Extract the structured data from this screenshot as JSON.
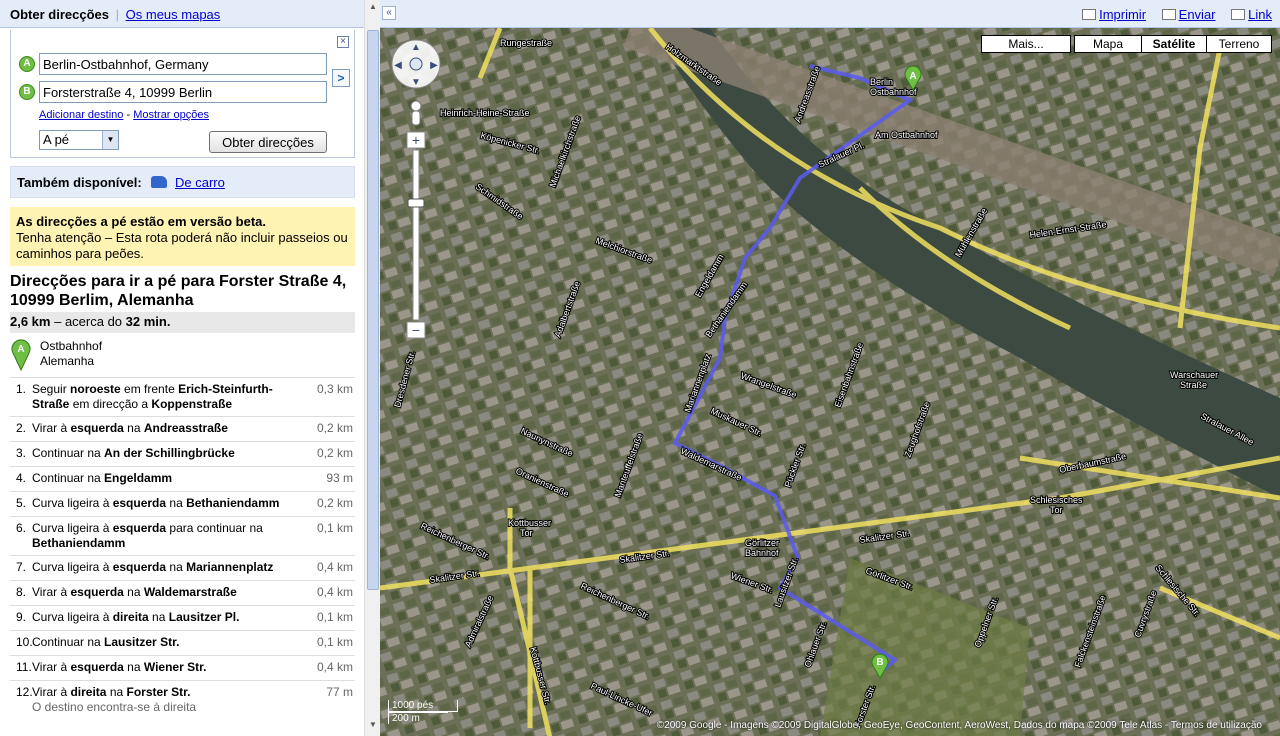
{
  "nav": {
    "current": "Obter direcções",
    "mymaps": "Os meus mapas"
  },
  "form": {
    "from": "Berlin-Ostbahnhof, Germany",
    "to": "Forsterstraße 4, 10999 Berlin",
    "marker_a": "A",
    "marker_b": "B",
    "add_dest": "Adicionar destino",
    "link_sep": "-",
    "show_options": "Mostrar opções",
    "mode": "A pé",
    "get_dir": "Obter direcções",
    "close": "×",
    "swap": ">"
  },
  "also": {
    "label": "Também disponível:",
    "link": "De carro"
  },
  "beta": {
    "title": "As direcções a pé estão em versão beta.",
    "body": "Tenha atenção – Esta rota poderá não incluir passeios ou caminhos para peões."
  },
  "route": {
    "title": "Direcções para ir a pé para Forster Straße 4, 10999 Berlim, Alemanha",
    "distance": "2,6 km",
    "approx": "– acerca do",
    "time": "32 min.",
    "start_name": "Ostbahnhof",
    "start_country": "Alemanha"
  },
  "steps": [
    {
      "n": "1.",
      "text": "Seguir <b>noroeste</b> em frente <b>Erich-Steinfurth-Straße</b> em direcção a <b>Koppenstraße</b>",
      "dist": "0,3 km"
    },
    {
      "n": "2.",
      "text": "Virar à <b>esquerda</b> na <b>Andreasstraße</b>",
      "dist": "0,2 km"
    },
    {
      "n": "3.",
      "text": "Continuar na <b>An der Schillingbrücke</b>",
      "dist": "0,2 km"
    },
    {
      "n": "4.",
      "text": "Continuar na <b>Engeldamm</b>",
      "dist": "93 m"
    },
    {
      "n": "5.",
      "text": "Curva ligeira à <b>esquerda</b> na <b>Bethaniendamm</b>",
      "dist": "0,2 km"
    },
    {
      "n": "6.",
      "text": "Curva ligeira à <b>esquerda</b> para continuar na <b>Bethaniendamm</b>",
      "dist": "0,1 km"
    },
    {
      "n": "7.",
      "text": "Curva ligeira à <b>esquerda</b> na <b>Mariannenplatz</b>",
      "dist": "0,4 km"
    },
    {
      "n": "8.",
      "text": "Virar à <b>esquerda</b> na <b>Waldemarstraße</b>",
      "dist": "0,4 km"
    },
    {
      "n": "9.",
      "text": "Curva ligeira à <b>direita</b> na <b>Lausitzer Pl.</b>",
      "dist": "0,1 km"
    },
    {
      "n": "10.",
      "text": "Continuar na <b>Lausitzer Str.</b>",
      "dist": "0,1 km"
    },
    {
      "n": "11.",
      "text": "Virar à <b>esquerda</b> na <b>Wiener Str.</b>",
      "dist": "0,4 km"
    },
    {
      "n": "12.",
      "text": "Virar à <b>direita</b> na <b>Forster Str.</b>",
      "dist": "77 m",
      "sub": "O destino encontra-se à direita"
    }
  ],
  "map": {
    "print": "Imprimir",
    "send": "Enviar",
    "link": "Link",
    "types": [
      "Mais...",
      "Mapa",
      "Satélite",
      "Terreno"
    ],
    "active_type": "Satélite",
    "copyright": "©2009 Google - Imagens ©2009 DigitalGlobe, GeoEye, GeoContent, AeroWest, Dados do mapa ©2009 Tele Atlas - Termos de utilização",
    "scale_ft": "1000 pés",
    "scale_m": "200 m",
    "route_color": "#5a5af0",
    "streets": [
      "Rungestraße",
      "Holzmarktstraße",
      "Andreasstraße",
      "Berlin Ostbahnhof",
      "Am Ostbahnhof",
      "Stralauer Pl.",
      "Mühlenstraße",
      "Köpenicker Str.",
      "Schmidstraße",
      "Michaelkirchstraße",
      "Melchiorstraße",
      "Engeldamm",
      "Bethaniendamm",
      "Mariannenplatz",
      "Waldemarstraße",
      "Naunynstraße",
      "Oranienstraße",
      "Muskauer Str.",
      "Wrangelstraße",
      "Skalitzer Str.",
      "Görlitzer Bahnhof",
      "Kottbusser Tor",
      "Wiener Str.",
      "Lausitzer Str.",
      "Reichenberger Str.",
      "Oberbaumstraße",
      "Schlesisches Tor",
      "Warschauer Straße",
      "Stralauer Allee",
      "Helen-Ernst-Straße",
      "Schlesische Str.",
      "Heinrich-Heine-Straße",
      "Eisenbahnstraße",
      "Manteuffelstraße",
      "Adalbertstraße",
      "Oppelner Str.",
      "Falckensteinstraße",
      "Cuvrystraße",
      "Görlitzer Str.",
      "Mittelweg",
      "Dresdener Str.",
      "Kottbusser Str.",
      "Admiralstraße",
      "Paul-Lincke-Ufer",
      "Ohlauer Str.",
      "Forster Str.",
      "Zeughofstraße",
      "Pückler Str."
    ]
  }
}
